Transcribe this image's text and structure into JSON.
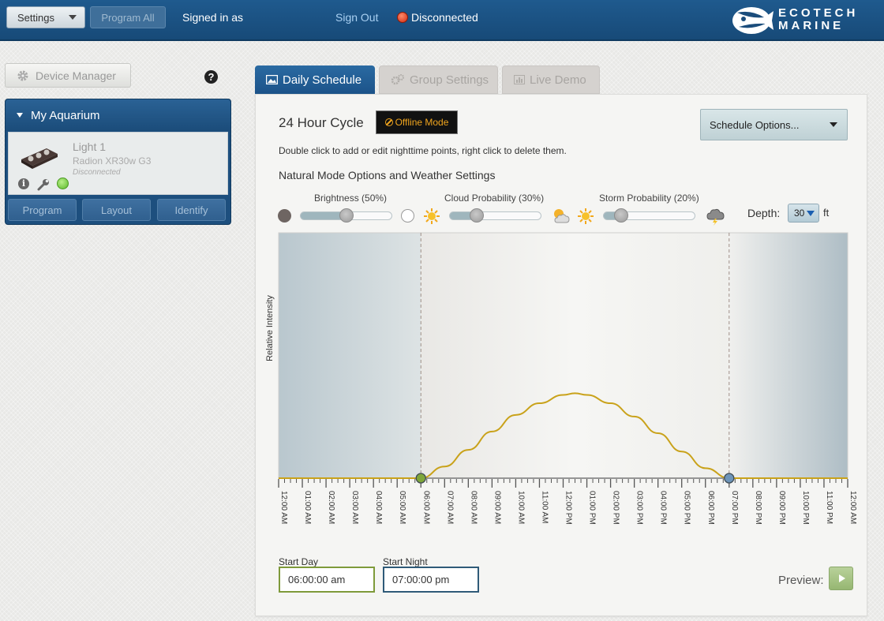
{
  "topbar": {
    "settings_label": "Settings",
    "program_all_label": "Program All",
    "signed_in_text": "Signed in as",
    "sign_out_label": "Sign Out",
    "connection_status": "Disconnected",
    "logo_line1": "ECOTECH",
    "logo_line2": "MARINE"
  },
  "sidebar": {
    "device_manager_label": "Device Manager",
    "help_glyph": "?",
    "aquarium": {
      "title": "My Aquarium",
      "light": {
        "name": "Light 1",
        "model": "Radion XR30w G3",
        "status": "Disconnected"
      },
      "buttons": [
        "Program",
        "Layout",
        "Identify"
      ]
    }
  },
  "tabs": [
    {
      "label": "Daily Schedule",
      "icon": "image-icon",
      "active": true
    },
    {
      "label": "Group Settings",
      "icon": "gears-icon",
      "active": false
    },
    {
      "label": "Live Demo",
      "icon": "bar-chart-icon",
      "active": false
    }
  ],
  "schedule": {
    "title": "24 Hour Cycle",
    "offline_badge": "Offline Mode",
    "options_label": "Schedule Options...",
    "instructions": "Double click to add or edit nighttime points, right click to delete them.",
    "natural_mode_title": "Natural Mode Options and Weather Settings",
    "sliders": [
      {
        "label": "Brightness (50%)",
        "value": 50
      },
      {
        "label": "Cloud Probability (30%)",
        "value": 30
      },
      {
        "label": "Storm Probability (20%)",
        "value": 20
      }
    ],
    "depth_label": "Depth:",
    "depth_value": "30",
    "depth_unit": "ft",
    "start_day_label": "Start Day",
    "start_day_value": "06:00:00 am",
    "start_night_label": "Start Night",
    "start_night_value": "07:00:00 pm",
    "preview_label": "Preview:"
  },
  "chart_data": {
    "type": "line",
    "ylabel": "Relative Intensity",
    "x_ticks": [
      "12:00 AM",
      "01:00 AM",
      "02:00 AM",
      "03:00 AM",
      "04:00 AM",
      "05:00 AM",
      "06:00 AM",
      "07:00 AM",
      "08:00 AM",
      "09:00 AM",
      "10:00 AM",
      "11:00 AM",
      "12:00 PM",
      "01:00 PM",
      "02:00 PM",
      "03:00 PM",
      "04:00 PM",
      "05:00 PM",
      "06:00 PM",
      "07:00 PM",
      "08:00 PM",
      "09:00 PM",
      "10:00 PM",
      "11:00 PM",
      "12:00 AM"
    ],
    "xlim": [
      0,
      24
    ],
    "ylim": [
      0,
      100
    ],
    "day_start_hour": 6,
    "night_start_hour": 19,
    "series": [
      {
        "color": "#c9a21a",
        "x": [
          0,
          6,
          7,
          8,
          9,
          10,
          11,
          12,
          12.5,
          13,
          14,
          15,
          16,
          17,
          18,
          19,
          24
        ],
        "y": [
          0,
          0,
          7,
          17,
          28,
          38,
          45,
          50,
          51,
          50,
          45,
          37,
          27,
          16,
          6,
          0,
          0
        ]
      }
    ],
    "markers": [
      {
        "x": 6,
        "y": 0,
        "color": "#7ea63a"
      },
      {
        "x": 19,
        "y": 0,
        "color": "#6d94b8"
      }
    ]
  }
}
